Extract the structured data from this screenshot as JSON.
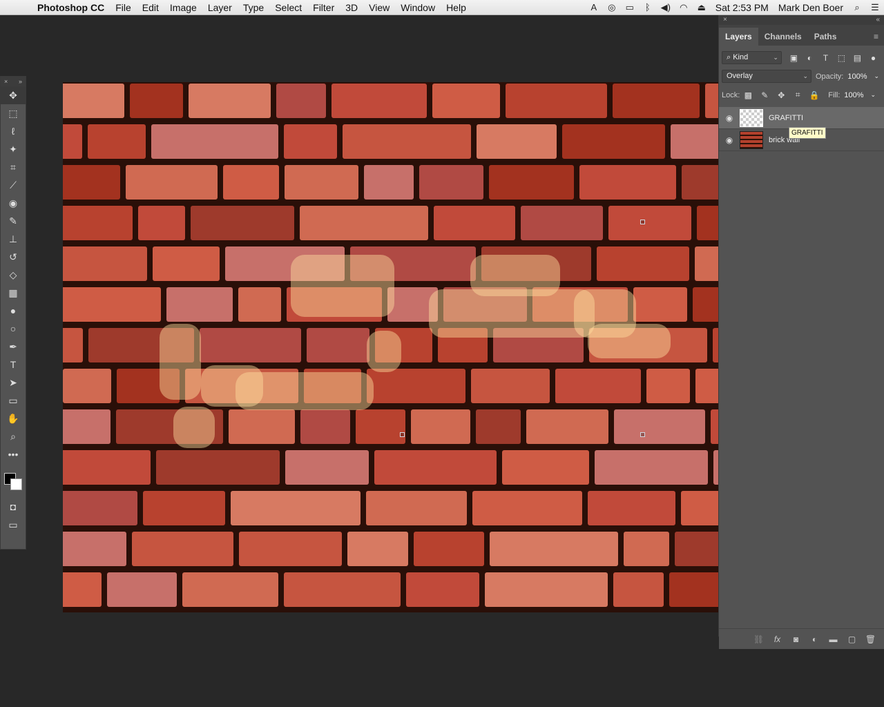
{
  "menubar": {
    "app_name": "Photoshop CC",
    "items": [
      "File",
      "Edit",
      "Image",
      "Layer",
      "Type",
      "Select",
      "Filter",
      "3D",
      "View",
      "Window",
      "Help"
    ],
    "clock": "Sat 2:53 PM",
    "user": "Mark Den Boer"
  },
  "panel": {
    "tabs": [
      "Layers",
      "Channels",
      "Paths"
    ],
    "filter_kind": "Kind",
    "blend_mode": "Overlay",
    "opacity_label": "Opacity:",
    "opacity_value": "100%",
    "lock_label": "Lock:",
    "fill_label": "Fill:",
    "fill_value": "100%",
    "layers": [
      {
        "name": "GRAFITTI",
        "selected": true
      },
      {
        "name": "brick wall",
        "selected": false
      }
    ],
    "tooltip": "GRAFITTI"
  },
  "colors": {
    "foreground": "#000000",
    "background": "#ffffff",
    "accent_panel": "#535353"
  }
}
